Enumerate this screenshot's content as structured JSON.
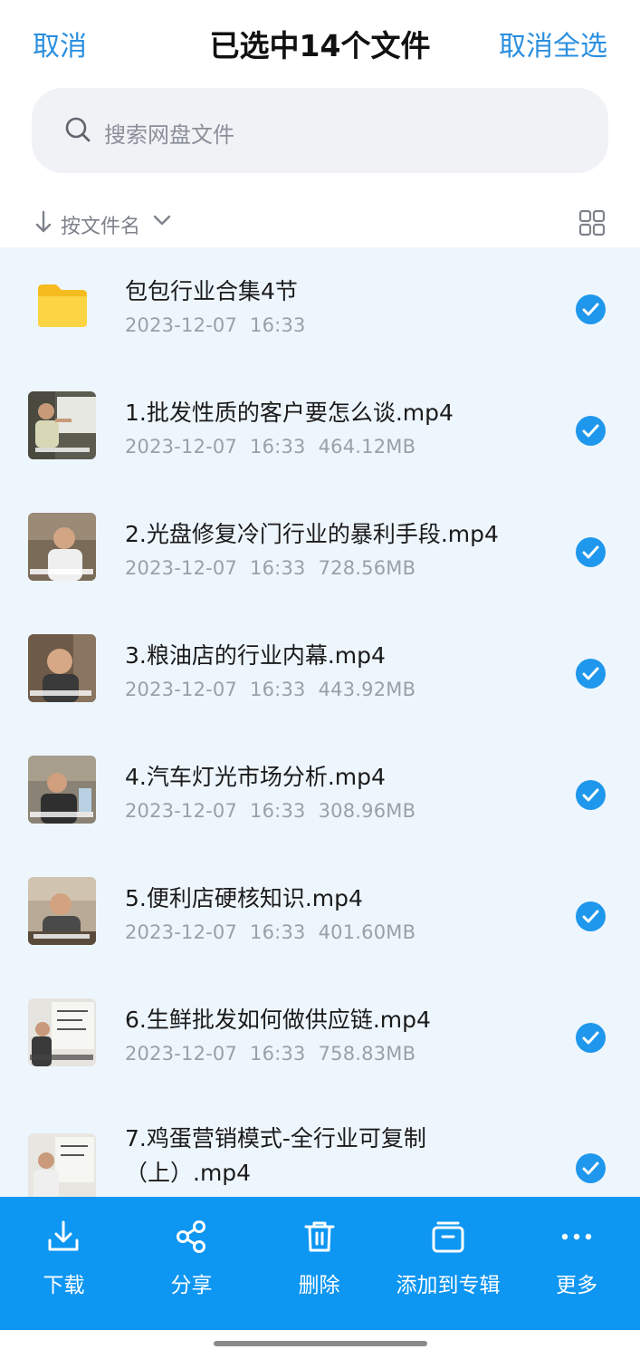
{
  "header": {
    "cancel_label": "取消",
    "title": "已选中14个文件",
    "cancel_all_label": "取消全选"
  },
  "search": {
    "placeholder": "搜索网盘文件"
  },
  "sort": {
    "label": "按文件名"
  },
  "files": [
    {
      "name": "包包行业合集4节",
      "date": "2023-12-07",
      "time": "16:33",
      "size": "",
      "type": "folder",
      "selected": true
    },
    {
      "name": "1.批发性质的客户要怎么谈.mp4",
      "date": "2023-12-07",
      "time": "16:33",
      "size": "464.12MB",
      "type": "video",
      "selected": true
    },
    {
      "name": "2.光盘修复冷门行业的暴利手段.mp4",
      "date": "2023-12-07",
      "time": "16:33",
      "size": "728.56MB",
      "type": "video",
      "selected": true
    },
    {
      "name": "3.粮油店的行业内幕.mp4",
      "date": "2023-12-07",
      "time": "16:33",
      "size": "443.92MB",
      "type": "video",
      "selected": true
    },
    {
      "name": "4.汽车灯光市场分析.mp4",
      "date": "2023-12-07",
      "time": "16:33",
      "size": "308.96MB",
      "type": "video",
      "selected": true
    },
    {
      "name": "5.便利店硬核知识.mp4",
      "date": "2023-12-07",
      "time": "16:33",
      "size": "401.60MB",
      "type": "video",
      "selected": true
    },
    {
      "name": "6.生鲜批发如何做供应链.mp4",
      "date": "2023-12-07",
      "time": "16:33",
      "size": "758.83MB",
      "type": "video",
      "selected": true
    },
    {
      "name": "7.鸡蛋营销模式-全行业可复制",
      "name_line2": "（上）.mp4",
      "date": "",
      "time": "",
      "size": "",
      "type": "video",
      "selected": true
    }
  ],
  "toolbar": {
    "download_label": "下载",
    "share_label": "分享",
    "delete_label": "删除",
    "add_album_label": "添加到专辑",
    "more_label": "更多"
  },
  "colors": {
    "accent": "#2b8fe0",
    "toolbar_bg": "#0d96f2",
    "list_bg": "#eef6fd",
    "check": "#1e97ec"
  }
}
